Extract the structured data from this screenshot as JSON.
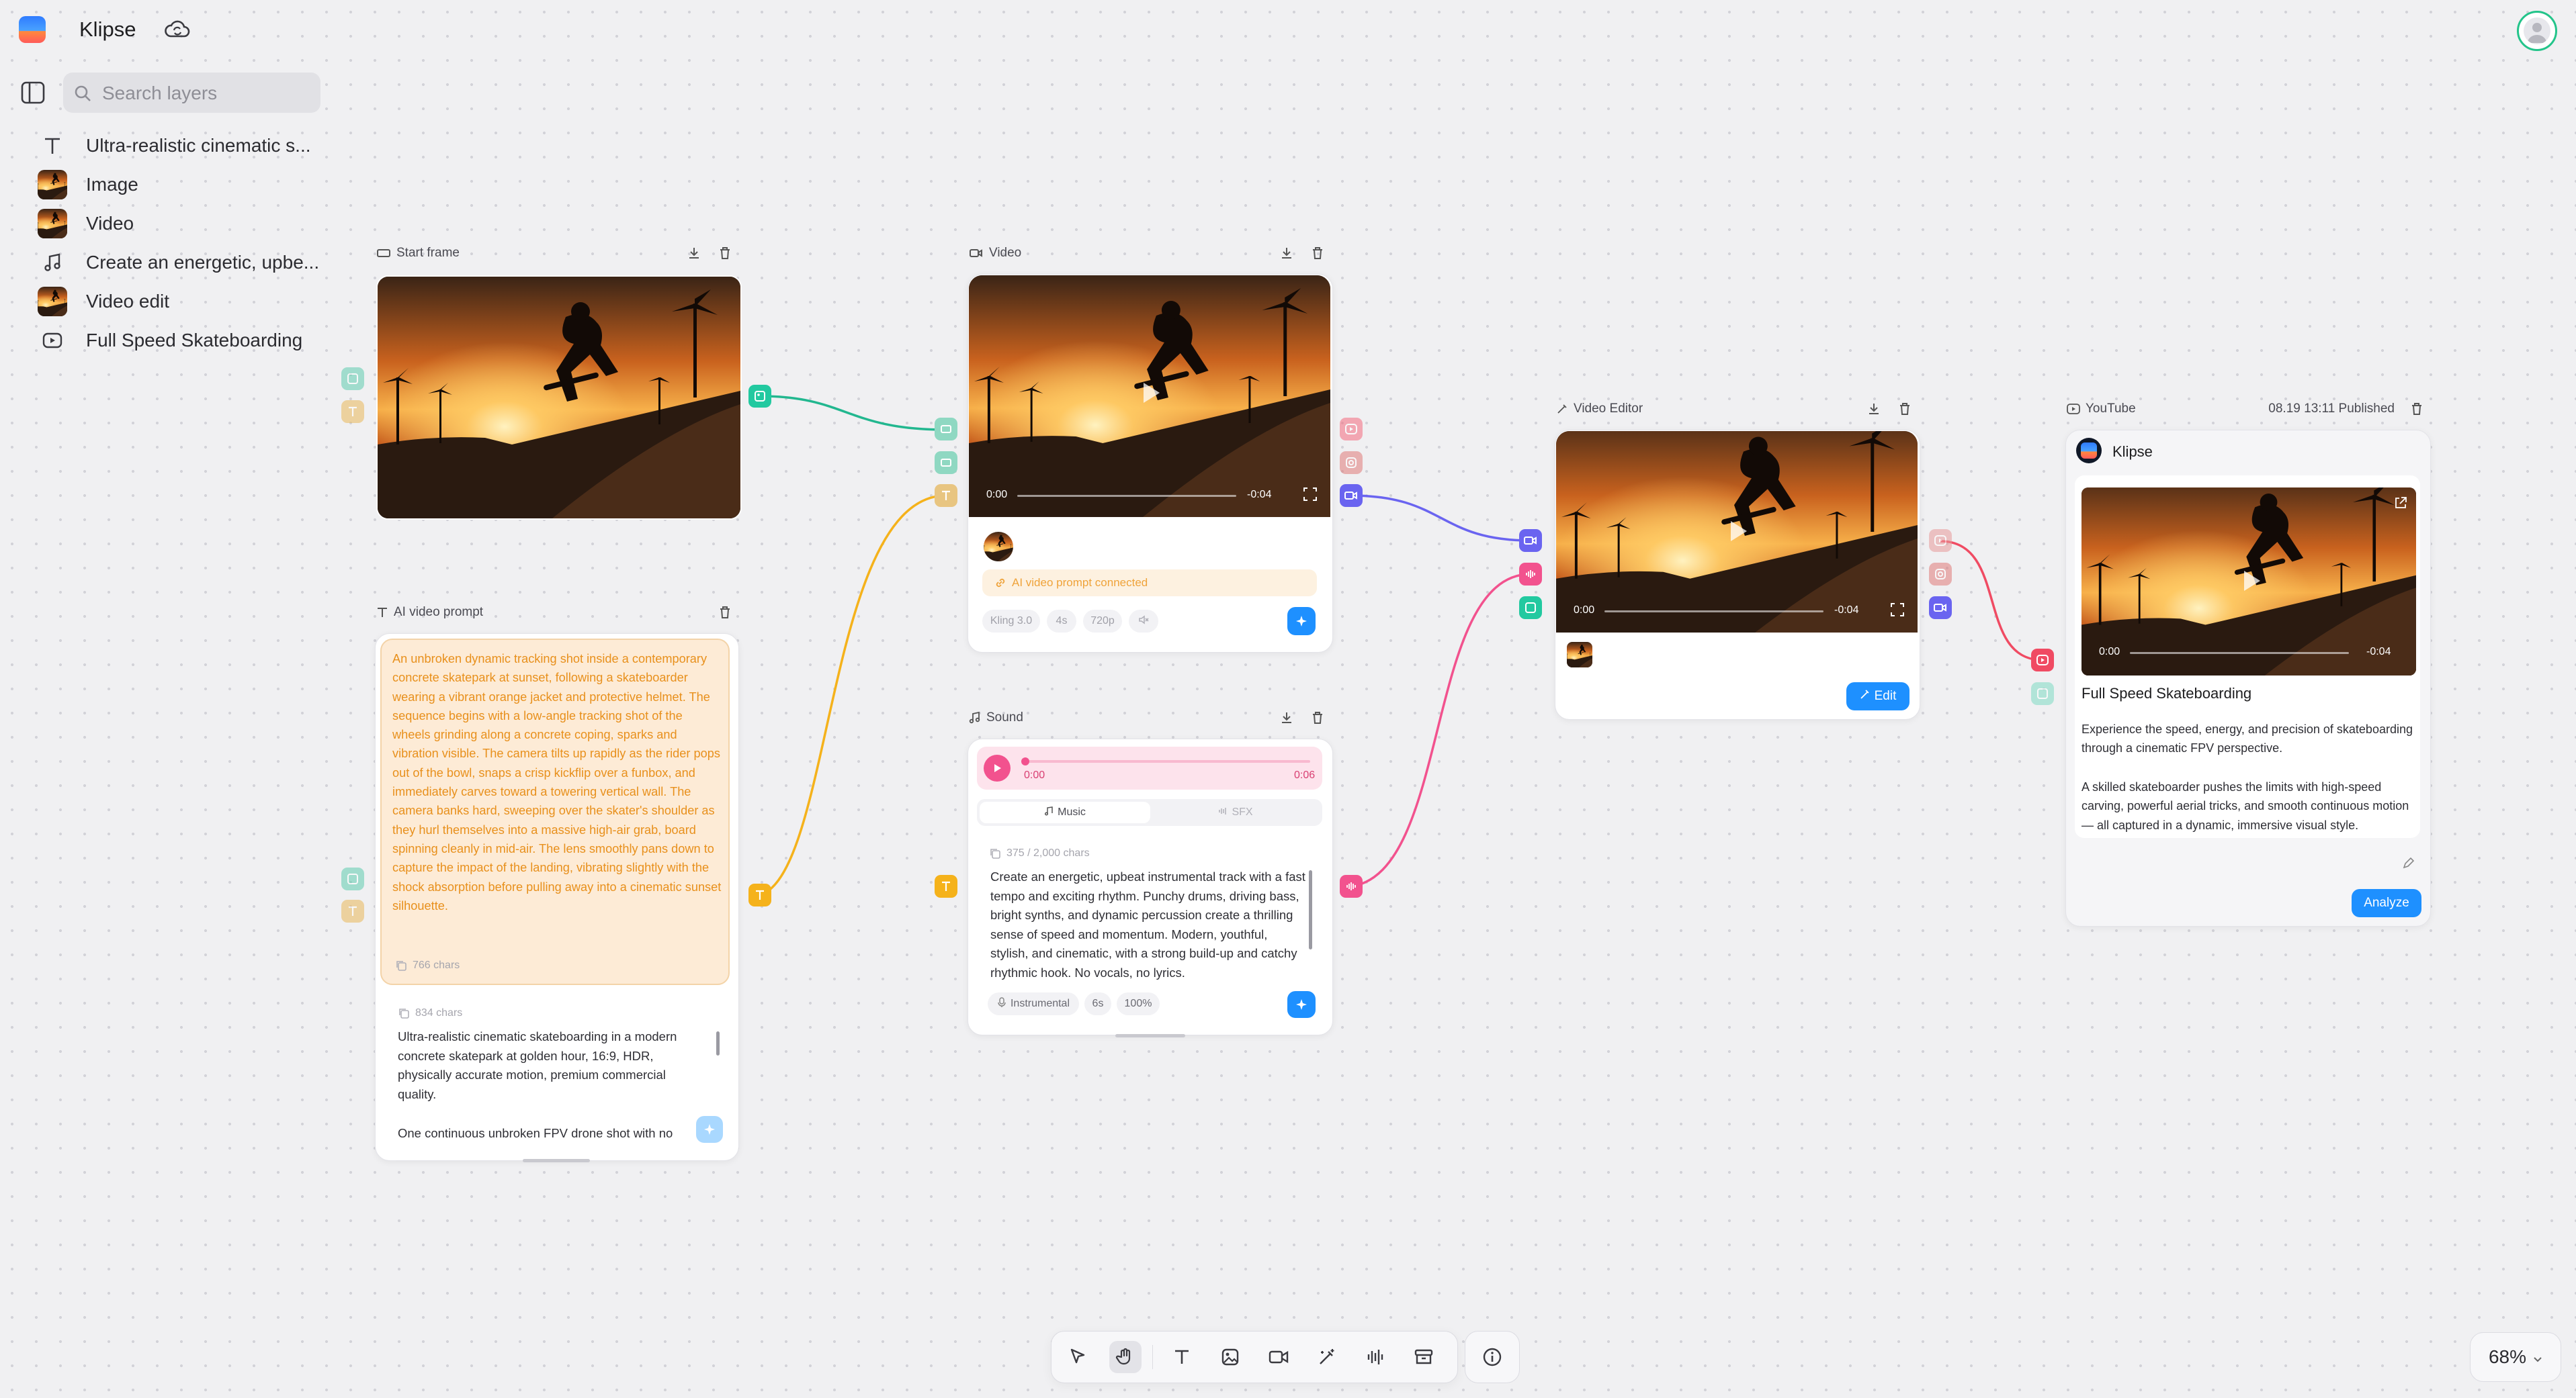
{
  "app": {
    "title": "Klipse"
  },
  "sidebar": {
    "search_placeholder": "Search layers",
    "layers": [
      {
        "label": "Ultra-realistic cinematic s...",
        "icon": "text-icon"
      },
      {
        "label": "Image",
        "icon": "image-thumb"
      },
      {
        "label": "Video",
        "icon": "video-thumb"
      },
      {
        "label": "Create an energetic, upbe...",
        "icon": "music-note-icon"
      },
      {
        "label": "Video edit",
        "icon": "video-thumb"
      },
      {
        "label": "Full Speed Skateboarding",
        "icon": "youtube-icon"
      }
    ]
  },
  "nodes": {
    "start_frame": {
      "title": "Start frame"
    },
    "video": {
      "title": "Video",
      "time_start": "0:00",
      "time_end": "-0:04",
      "connected_label": "AI video prompt connected",
      "options": [
        "Kling 3.0",
        "4s",
        "720p"
      ]
    },
    "ai_prompt": {
      "title": "AI video prompt",
      "prompt_text": "An unbroken dynamic tracking shot inside a contemporary concrete skatepark at sunset, following a skateboarder wearing a vibrant orange jacket and protective helmet. The sequence begins with a low-angle tracking shot of the wheels grinding along a concrete coping, sparks and vibration visible. The camera tilts up rapidly as the rider pops out of the bowl, snaps a crisp kickflip over a funbox, and immediately carves toward a towering vertical wall. The camera banks hard, sweeping over the skater's shoulder as they hurl themselves into a massive high-air grab, board spinning cleanly in mid-air. The lens smoothly pans down to capture the impact of the landing, vibrating slightly with the shock absorption before pulling away into a cinematic sunset silhouette.",
      "prompt_chars": "766 chars",
      "input_chars": "834 chars",
      "input_text_1": "Ultra-realistic cinematic skateboarding in a modern concrete skatepark at golden hour, 16:9, HDR, physically accurate motion, premium commercial quality.",
      "input_text_2": "One continuous unbroken FPV drone shot with no"
    },
    "sound": {
      "title": "Sound",
      "time_start": "0:00",
      "time_end": "0:06",
      "tabs": [
        "Music",
        "SFX"
      ],
      "chars": "375 / 2,000 chars",
      "text": "Create an energetic, upbeat instrumental track with a fast tempo and exciting rhythm. Punchy drums, driving bass, bright synths, and dynamic percussion create a thrilling sense of speed and momentum. Modern, youthful, stylish, and cinematic, with a strong build-up and catchy rhythmic hook. No vocals, no lyrics.",
      "options": [
        "Instrumental",
        "6s",
        "100%"
      ]
    },
    "video_editor": {
      "title": "Video Editor",
      "time_start": "0:00",
      "time_end": "-0:04",
      "edit_label": "Edit"
    },
    "youtube": {
      "title": "YouTube",
      "status": "08.19 13:11 Published",
      "channel": "Klipse",
      "time_start": "0:00",
      "time_end": "-0:04",
      "video_title": "Full Speed Skateboarding",
      "desc_1": "Experience the speed, energy, and precision of skateboarding through a cinematic FPV perspective.",
      "desc_2": "A skilled skateboarder pushes the limits with high-speed carving, powerful aerial tricks, and smooth continuous motion — all captured in a dynamic, immersive visual style.",
      "analyze_label": "Analyze"
    }
  },
  "toolbar": {
    "tools": [
      "pointer-icon",
      "hand-icon",
      "text-icon",
      "image-icon",
      "video-icon",
      "magic-wand-icon",
      "audio-wave-icon",
      "archive-icon"
    ],
    "active_tool": "hand-icon"
  },
  "zoom": {
    "level": "68%"
  },
  "colors": {
    "accent_blue": "#1e90ff",
    "image_port": "#22c9a0",
    "text_port": "#f5b21b",
    "video_port": "#6a64f0",
    "youtube_port": "#f04b63",
    "audio_port": "#f2528e",
    "prompt_orange": "#e8901c"
  }
}
